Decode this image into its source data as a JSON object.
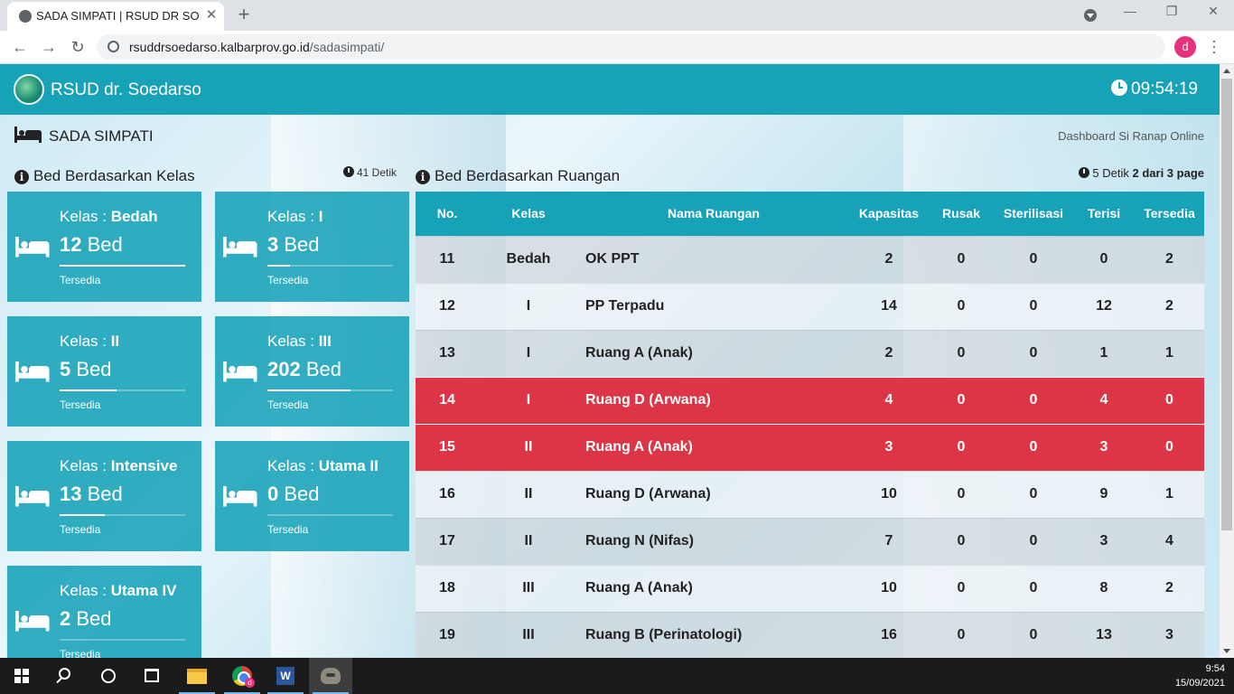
{
  "browser": {
    "tab_title": "SADA SIMPATI | RSUD DR SO",
    "url_host": "rsuddrsoedarso.kalbarprov.go.id",
    "url_path": "/sadasimpati/",
    "profile_initial": "d"
  },
  "header": {
    "brand": "RSUD dr. Soedarso",
    "time": "09:54:19"
  },
  "page": {
    "title": "SADA SIMPATI",
    "subtitle": "Dashboard Si Ranap Online"
  },
  "kelas_panel": {
    "heading": "Bed Berdasarkan Kelas",
    "timer": "41 Detik",
    "kelas_prefix": "Kelas : ",
    "bed_unit": " Bed",
    "status_label": "Tersedia",
    "cards": [
      {
        "kelas": "Bedah",
        "count": "12",
        "fill": 1.0
      },
      {
        "kelas": "I",
        "count": "3",
        "fill": 0.18
      },
      {
        "kelas": "II",
        "count": "5",
        "fill": 0.45
      },
      {
        "kelas": "III",
        "count": "202",
        "fill": 0.66
      },
      {
        "kelas": "Intensive",
        "count": "13",
        "fill": 0.36
      },
      {
        "kelas": "Utama II",
        "count": "0",
        "fill": 0.0
      },
      {
        "kelas": "Utama IV",
        "count": "2",
        "fill": 0.0
      }
    ]
  },
  "ruangan_panel": {
    "heading": "Bed Berdasarkan Ruangan",
    "timer": "5 Detik",
    "paging": "2 dari 3 page",
    "columns": [
      "No.",
      "Kelas",
      "Nama Ruangan",
      "Kapasitas",
      "Rusak",
      "Sterilisasi",
      "Terisi",
      "Tersedia"
    ],
    "rows": [
      {
        "no": "11",
        "kelas": "Bedah",
        "nama": "OK PPT",
        "kapasitas": "2",
        "rusak": "0",
        "sterilisasi": "0",
        "terisi": "0",
        "tersedia": "2",
        "full": false
      },
      {
        "no": "12",
        "kelas": "I",
        "nama": "PP Terpadu",
        "kapasitas": "14",
        "rusak": "0",
        "sterilisasi": "0",
        "terisi": "12",
        "tersedia": "2",
        "full": false
      },
      {
        "no": "13",
        "kelas": "I",
        "nama": "Ruang A (Anak)",
        "kapasitas": "2",
        "rusak": "0",
        "sterilisasi": "0",
        "terisi": "1",
        "tersedia": "1",
        "full": false
      },
      {
        "no": "14",
        "kelas": "I",
        "nama": "Ruang D (Arwana)",
        "kapasitas": "4",
        "rusak": "0",
        "sterilisasi": "0",
        "terisi": "4",
        "tersedia": "0",
        "full": true
      },
      {
        "no": "15",
        "kelas": "II",
        "nama": "Ruang A (Anak)",
        "kapasitas": "3",
        "rusak": "0",
        "sterilisasi": "0",
        "terisi": "3",
        "tersedia": "0",
        "full": true
      },
      {
        "no": "16",
        "kelas": "II",
        "nama": "Ruang D (Arwana)",
        "kapasitas": "10",
        "rusak": "0",
        "sterilisasi": "0",
        "terisi": "9",
        "tersedia": "1",
        "full": false
      },
      {
        "no": "17",
        "kelas": "II",
        "nama": "Ruang N (Nifas)",
        "kapasitas": "7",
        "rusak": "0",
        "sterilisasi": "0",
        "terisi": "3",
        "tersedia": "4",
        "full": false
      },
      {
        "no": "18",
        "kelas": "III",
        "nama": "Ruang A (Anak)",
        "kapasitas": "10",
        "rusak": "0",
        "sterilisasi": "0",
        "terisi": "8",
        "tersedia": "2",
        "full": false
      },
      {
        "no": "19",
        "kelas": "III",
        "nama": "Ruang B (Perinatologi)",
        "kapasitas": "16",
        "rusak": "0",
        "sterilisasi": "0",
        "terisi": "13",
        "tersedia": "3",
        "full": false
      }
    ]
  },
  "taskbar": {
    "time": "9:54",
    "date": "15/09/2021"
  }
}
